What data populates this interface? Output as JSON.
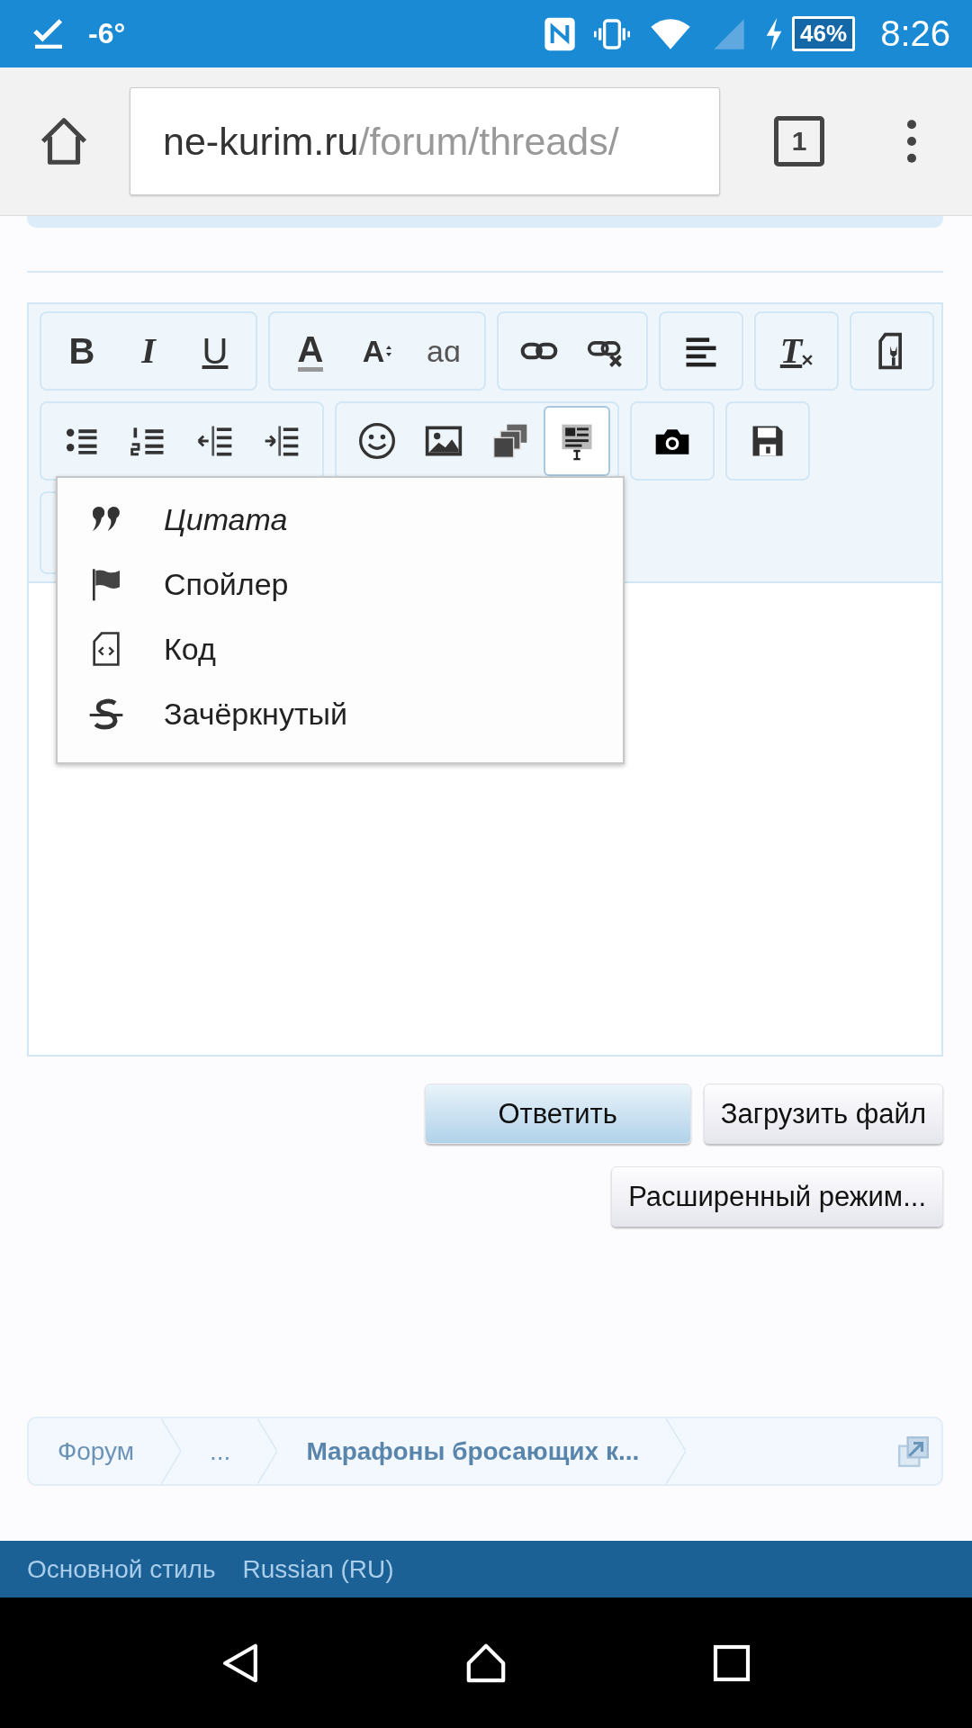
{
  "status_bar": {
    "temperature": "-6°",
    "battery": "46%",
    "time": "8:26"
  },
  "browser": {
    "url_domain": "ne-kurim.ru",
    "url_path": "/forum/threads/",
    "tab_count": "1"
  },
  "editor": {
    "toolbar_rows": [
      {
        "groups": [
          {
            "buttons": [
              {
                "kind": "bold",
                "glyph": "B",
                "selected": false
              },
              {
                "kind": "italic",
                "glyph": "I",
                "selected": false
              },
              {
                "kind": "underline",
                "glyph": "U",
                "selected": false
              }
            ]
          },
          {
            "buttons": [
              {
                "kind": "font-color",
                "glyph": "A",
                "selected": false
              },
              {
                "kind": "font-size",
                "glyph": "A",
                "selected": false
              },
              {
                "kind": "font-family",
                "glyph": "aɑ",
                "selected": false
              }
            ]
          },
          {
            "buttons": [
              {
                "kind": "link",
                "selected": false
              },
              {
                "kind": "unlink",
                "selected": false
              }
            ]
          },
          {
            "buttons": [
              {
                "kind": "align",
                "selected": false
              }
            ]
          },
          {
            "buttons": [
              {
                "kind": "remove-format",
                "glyph": "T",
                "selected": false
              }
            ]
          },
          {
            "buttons": [
              {
                "kind": "source",
                "selected": false
              }
            ]
          }
        ]
      },
      {
        "groups": [
          {
            "buttons": [
              {
                "kind": "bullet-list",
                "selected": false
              },
              {
                "kind": "number-list",
                "selected": false
              },
              {
                "kind": "outdent",
                "selected": false
              },
              {
                "kind": "indent",
                "selected": false
              }
            ]
          },
          {
            "buttons": [
              {
                "kind": "smilies",
                "selected": false
              },
              {
                "kind": "image",
                "selected": false
              },
              {
                "kind": "media",
                "selected": false
              },
              {
                "kind": "more",
                "selected": true
              }
            ]
          },
          {
            "buttons": [
              {
                "kind": "camera",
                "selected": false
              }
            ]
          },
          {
            "buttons": [
              {
                "kind": "save",
                "selected": false
              }
            ]
          }
        ]
      }
    ],
    "dropdown": {
      "items": [
        {
          "kind": "quote",
          "label": "Цитата",
          "italic": true
        },
        {
          "kind": "spoiler",
          "label": "Спойлер",
          "italic": false
        },
        {
          "kind": "code",
          "label": "Код",
          "italic": false
        },
        {
          "kind": "strike",
          "label": "Зачёркнутый",
          "italic": false
        }
      ]
    }
  },
  "buttons": [
    {
      "label": "Ответить",
      "primary": true
    },
    {
      "label": "Загрузить файл",
      "primary": false
    },
    {
      "label": "Расширенный режим...",
      "primary": false
    }
  ],
  "breadcrumb": [
    {
      "label": "Форум",
      "current": false
    },
    {
      "label": "...",
      "current": false
    },
    {
      "label": "Марафоны бросающих к...",
      "current": true
    }
  ],
  "footer_links": [
    "Основной стиль",
    "Russian (RU)"
  ]
}
